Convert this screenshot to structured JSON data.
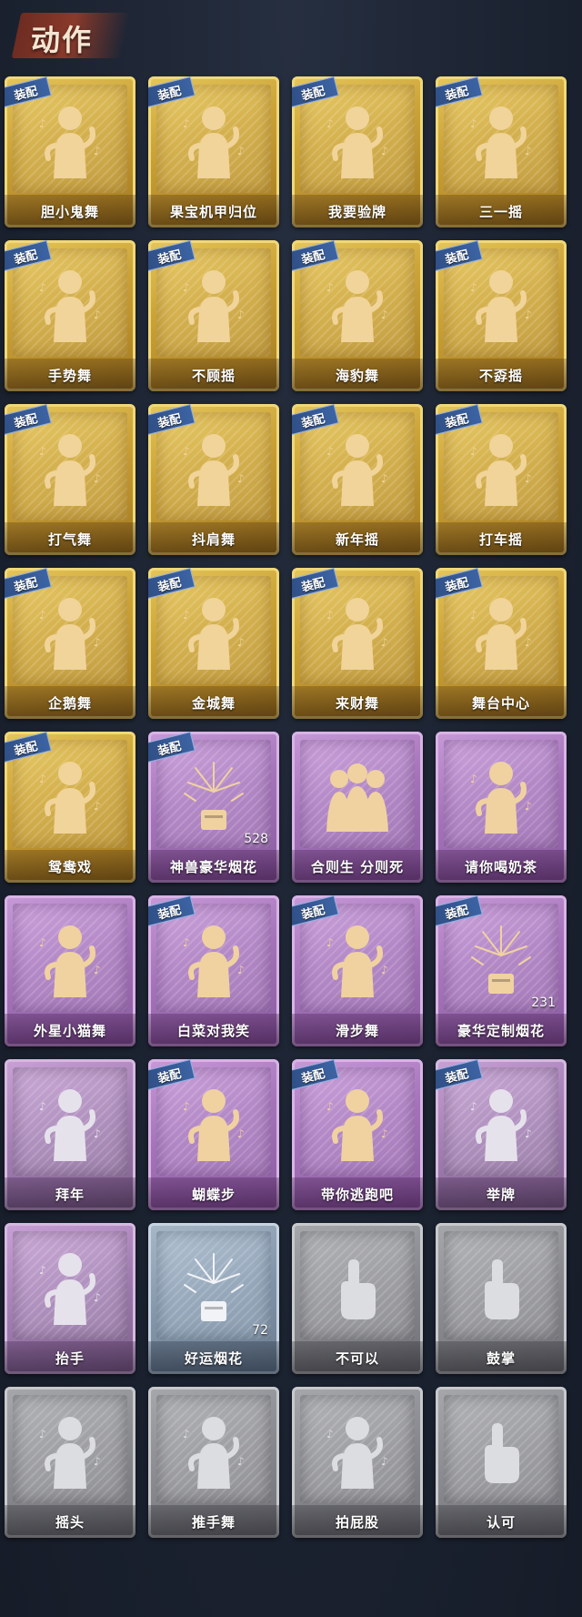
{
  "header": {
    "title": "动作"
  },
  "badge_label": "装配",
  "colors": {
    "gold": "#caa237",
    "purple": "#a473b9",
    "blue": "#8294a8",
    "gray": "#88898e",
    "badge": "#3c63a3"
  },
  "cards": [
    {
      "label": "胆小鬼舞",
      "rarity": "gold",
      "equipped": true,
      "icon": "timid-dance-figure-icon"
    },
    {
      "label": "果宝机甲归位",
      "rarity": "gold",
      "equipped": true,
      "icon": "mecha-pose-figure-icon"
    },
    {
      "label": "我要验牌",
      "rarity": "gold",
      "equipped": true,
      "icon": "card-check-figure-icon"
    },
    {
      "label": "三一摇",
      "rarity": "gold",
      "equipped": true,
      "icon": "sway-figure-icon"
    },
    {
      "label": "手势舞",
      "rarity": "gold",
      "equipped": true,
      "icon": "gesture-dance-figure-icon"
    },
    {
      "label": "不顾摇",
      "rarity": "gold",
      "equipped": true,
      "icon": "pointing-sway-figure-icon"
    },
    {
      "label": "海豹舞",
      "rarity": "gold",
      "equipped": true,
      "icon": "seal-dance-figure-icon"
    },
    {
      "label": "不孬摇",
      "rarity": "gold",
      "equipped": true,
      "icon": "arm-up-sway-figure-icon"
    },
    {
      "label": "打气舞",
      "rarity": "gold",
      "equipped": true,
      "icon": "cheer-dance-figure-icon"
    },
    {
      "label": "抖肩舞",
      "rarity": "gold",
      "equipped": true,
      "icon": "shoulder-shake-figure-icon"
    },
    {
      "label": "新年摇",
      "rarity": "gold",
      "equipped": true,
      "icon": "new-year-sway-figure-icon"
    },
    {
      "label": "打车摇",
      "rarity": "gold",
      "equipped": true,
      "icon": "taxi-sway-figure-icon"
    },
    {
      "label": "企鹅舞",
      "rarity": "gold",
      "equipped": true,
      "icon": "penguin-dance-figure-icon"
    },
    {
      "label": "金城舞",
      "rarity": "gold",
      "equipped": true,
      "icon": "jincheng-dance-figure-icon"
    },
    {
      "label": "来财舞",
      "rarity": "gold",
      "equipped": true,
      "icon": "fortune-dance-figure-icon"
    },
    {
      "label": "舞台中心",
      "rarity": "gold",
      "equipped": true,
      "icon": "center-stage-figure-icon"
    },
    {
      "label": "鸳鸯戏",
      "rarity": "gold",
      "equipped": true,
      "icon": "duet-figure-icon"
    },
    {
      "label": "神兽豪华烟花",
      "rarity": "purple",
      "equipped": true,
      "icon": "deluxe-firework-icon",
      "count": "528"
    },
    {
      "label": "合则生 分则死",
      "rarity": "purple",
      "equipped": false,
      "icon": "three-figures-icon"
    },
    {
      "label": "请你喝奶茶",
      "rarity": "purple",
      "equipped": false,
      "icon": "milk-tea-figure-icon"
    },
    {
      "label": "外星小猫舞",
      "rarity": "purple",
      "equipped": false,
      "icon": "alien-cat-dance-figure-icon"
    },
    {
      "label": "白菜对我笑",
      "rarity": "purple",
      "equipped": true,
      "icon": "cabbage-smile-figure-icon"
    },
    {
      "label": "滑步舞",
      "rarity": "purple",
      "equipped": true,
      "icon": "slide-dance-figure-icon"
    },
    {
      "label": "豪华定制烟花",
      "rarity": "purple",
      "equipped": true,
      "icon": "custom-firework-icon",
      "count": "231"
    },
    {
      "label": "拜年",
      "rarity": "lilac",
      "equipped": false,
      "icon": "greeting-figure-icon"
    },
    {
      "label": "蝴蝶步",
      "rarity": "purple",
      "equipped": true,
      "icon": "butterfly-step-figure-icon"
    },
    {
      "label": "带你逃跑吧",
      "rarity": "purple",
      "equipped": true,
      "icon": "run-away-figure-icon"
    },
    {
      "label": "举牌",
      "rarity": "lilac",
      "equipped": true,
      "icon": "hold-sign-figure-icon"
    },
    {
      "label": "抬手",
      "rarity": "lilac",
      "equipped": false,
      "icon": "raise-hand-figure-icon"
    },
    {
      "label": "好运烟花",
      "rarity": "blue",
      "equipped": false,
      "icon": "lucky-firework-icon",
      "count": "72"
    },
    {
      "label": "不可以",
      "rarity": "gray",
      "equipped": false,
      "icon": "finger-wag-icon"
    },
    {
      "label": "鼓掌",
      "rarity": "gray",
      "equipped": false,
      "icon": "clap-hands-icon"
    },
    {
      "label": "摇头",
      "rarity": "gray",
      "equipped": false,
      "icon": "shake-head-figure-icon"
    },
    {
      "label": "推手舞",
      "rarity": "gray",
      "equipped": false,
      "icon": "push-hand-dance-figure-icon"
    },
    {
      "label": "拍屁股",
      "rarity": "gray",
      "equipped": false,
      "icon": "butt-pat-figure-icon"
    },
    {
      "label": "认可",
      "rarity": "gray",
      "equipped": false,
      "icon": "thumbs-up-hand-icon"
    }
  ]
}
